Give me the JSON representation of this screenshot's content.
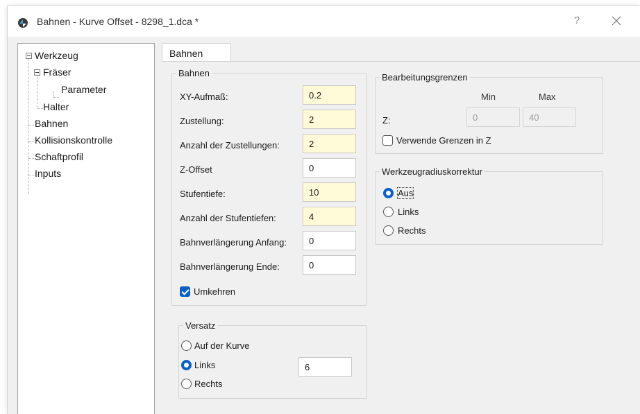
{
  "window": {
    "title": "Bahnen - Kurve Offset - 8298_1.dca *",
    "help_label": "?"
  },
  "tree": {
    "items": [
      {
        "label": "Werkzeug"
      },
      {
        "label": "Fräser"
      },
      {
        "label": "Parameter"
      },
      {
        "label": "Halter"
      },
      {
        "label": "Bahnen"
      },
      {
        "label": "Kollisionskontrolle"
      },
      {
        "label": "Schaftprofil"
      },
      {
        "label": "Inputs"
      }
    ]
  },
  "tab": {
    "label": "Bahnen"
  },
  "bahnen": {
    "title": "Bahnen",
    "fields": [
      {
        "label": "XY-Aufmaß:",
        "value": "0.2"
      },
      {
        "label": "Zustellung:",
        "value": "2"
      },
      {
        "label": "Anzahl der Zustellungen:",
        "value": "2"
      },
      {
        "label": "Z-Offset",
        "value": "0"
      },
      {
        "label": "Stufentiefe:",
        "value": "10"
      },
      {
        "label": "Anzahl der Stufentiefen:",
        "value": "4"
      },
      {
        "label": "Bahnverlängerung Anfang:",
        "value": "0"
      },
      {
        "label": "Bahnverlängerung Ende:",
        "value": "0"
      }
    ],
    "reverse_label": "Umkehren",
    "reverse_checked": true
  },
  "versatz": {
    "title": "Versatz",
    "options": [
      "Auf der Kurve",
      "Links",
      "Rechts"
    ],
    "selected": "Links",
    "value": "6"
  },
  "grenzen": {
    "title": "Bearbeitungsgrenzen",
    "min_label": "Min",
    "max_label": "Max",
    "z_label": "Z:",
    "z_min": "0",
    "z_max": "40",
    "use_limits_label": "Verwende Grenzen in Z",
    "use_limits_checked": false
  },
  "korrektur": {
    "title": "Werkzeugradiuskorrektur",
    "options": [
      "Aus",
      "Links",
      "Rechts"
    ],
    "selected": "Aus"
  },
  "colors": {
    "accent": "#0a5fc4",
    "highlight_field": "#fffbd8"
  }
}
